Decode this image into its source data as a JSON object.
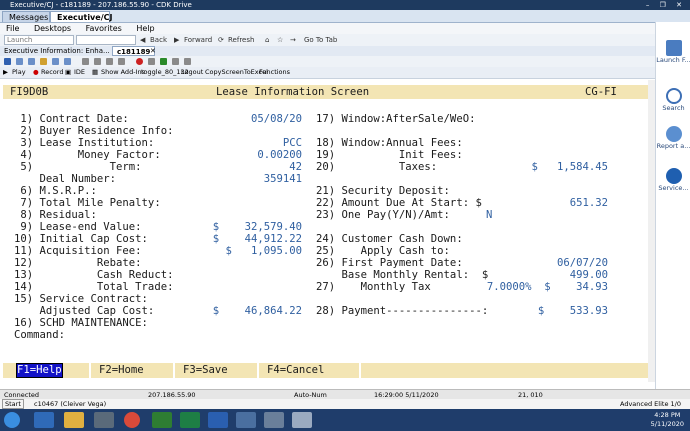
{
  "window": {
    "title": "Executive/CJ - c181189 - 207.186.55.90 - CDK Drive",
    "controls": "– ❐ ✕"
  },
  "tabs": [
    "Messages",
    "Executive/CJ"
  ],
  "menu": [
    "File",
    "Desktops",
    "Favorites",
    "Help"
  ],
  "nav": {
    "launch_placeholder": "Launch",
    "back": "Back",
    "forward": "Forward",
    "refresh": "Refresh",
    "goto_tab": "Go To Tab"
  },
  "subtabs": {
    "session": "Executive  Information:  Enha...",
    "active": "c181189"
  },
  "toolbar": [
    "Play",
    "Record",
    "IDE",
    "Show Add-Ins",
    "toggle_80_132",
    "Logout",
    "CopyScreenToExcel",
    "Functions"
  ],
  "screen": {
    "code": "FI9D0B",
    "title": "Lease Information Screen",
    "right_code": "CG-FI",
    "left": [
      {
        "label": " 1) Contract Date:",
        "value": "05/08/20"
      },
      {
        "label": " 2) Buyer Residence Info:",
        "value": ""
      },
      {
        "label": " 3) Lease Institution:",
        "value": "PCC"
      },
      {
        "label": " 4)       Money Factor:",
        "value": "0.00200"
      },
      {
        "label": " 5)            Term:",
        "value": "42"
      },
      {
        "label": "    Deal Number:",
        "value": "359141"
      },
      {
        "label": " 6) M.S.R.P.:",
        "value": ""
      },
      {
        "label": " 7) Total Mile Penalty:",
        "value": ""
      },
      {
        "label": " 8) Residual:",
        "value": ""
      },
      {
        "label": " 9) Lease-end Value:",
        "value": "$    32,579.40"
      },
      {
        "label": "10) Initial Cap Cost:",
        "value": "$    44,912.22"
      },
      {
        "label": "11) Acquisition Fee:",
        "value": "$   1,095.00"
      },
      {
        "label": "12)          Rebate:",
        "value": ""
      },
      {
        "label": "13)          Cash Reduct:",
        "value": ""
      },
      {
        "label": "14)          Total Trade:",
        "value": ""
      },
      {
        "label": "15) Service Contract:",
        "value": ""
      },
      {
        "label": "    Adjusted Cap Cost:",
        "value": "$    46,864.22"
      },
      {
        "label": "16) SCHD MAINTENANCE:",
        "value": ""
      },
      {
        "label": "Command:",
        "value": ""
      }
    ],
    "right": [
      {
        "label": "17) Window:AfterSale/WeO:",
        "value": ""
      },
      {
        "label": "",
        "value": ""
      },
      {
        "label": "18) Window:Annual Fees:",
        "value": ""
      },
      {
        "label": "19)          Init Fees:",
        "value": ""
      },
      {
        "label": "20)          Taxes:",
        "value": "$   1,584.45"
      },
      {
        "label": "",
        "value": ""
      },
      {
        "label": "21) Security Deposit:",
        "value": ""
      },
      {
        "label": "22) Amount Due At Start: $",
        "value": "651.32"
      },
      {
        "label": "23) One Pay(Y/N)/Amt:",
        "value": "N"
      },
      {
        "label": "",
        "value": ""
      },
      {
        "label": "24) Customer Cash Down:",
        "value": ""
      },
      {
        "label": "25)    Apply Cash to:",
        "value": ""
      },
      {
        "label": "26) First Payment Date:",
        "value": "06/07/20"
      },
      {
        "label": "    Base Monthly Rental:  $",
        "value": "499.00"
      },
      {
        "label": "27)    Monthly Tax",
        "value": "7.0000%  $    34.93"
      },
      {
        "label": "",
        "value": ""
      },
      {
        "label": "28) Payment---------------:",
        "value": "$    533.93"
      }
    ],
    "fkeys": [
      "F1=Help",
      "F2=Home",
      "F3=Save",
      "F4=Cancel"
    ]
  },
  "sidebar": [
    "Launch F...",
    "Search",
    "Report a...",
    "Service..."
  ],
  "status": {
    "state": "Connected",
    "ip": "207.186.55.90",
    "mode": "Auto-Num",
    "time": "16:29:00 5/11/2020",
    "pos": "21, 010"
  },
  "status2": {
    "user": "c10467 (Cleiver Vega)",
    "start": "Start",
    "product": "Advanced Elite  1/0"
  },
  "clock": {
    "time": "4:28 PM",
    "date": "5/11/2020"
  }
}
